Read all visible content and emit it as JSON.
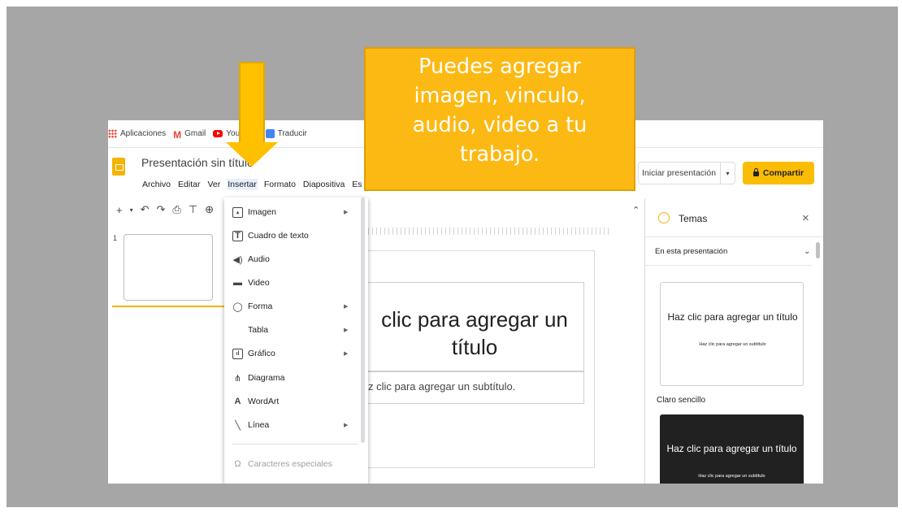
{
  "bookmarks": [
    {
      "icon": "apps-icon",
      "label": "Aplicaciones"
    },
    {
      "icon": "gmail-icon",
      "label": "Gmail"
    },
    {
      "icon": "youtube-icon",
      "label": "YouTube"
    },
    {
      "icon": "translate-icon",
      "label": "Traducir"
    }
  ],
  "header": {
    "doc_title": "Presentación sin título",
    "menus": [
      "Archivo",
      "Editar",
      "Ver",
      "Insertar",
      "Formato",
      "Diapositiva",
      "Es"
    ],
    "active_menu": "Insertar",
    "present_label": "Iniciar presentación",
    "share_label": "Compartir"
  },
  "filmstrip": {
    "slide_number": "1"
  },
  "insert_menu": {
    "items": [
      {
        "icon": "image-icon",
        "label": "Imagen",
        "submenu": true,
        "enabled": true
      },
      {
        "icon": "text-box-icon",
        "label": "Cuadro de texto",
        "submenu": false,
        "enabled": true
      },
      {
        "icon": "audio-icon",
        "label": "Audio",
        "submenu": false,
        "enabled": true
      },
      {
        "icon": "video-icon",
        "label": "Video",
        "submenu": false,
        "enabled": true
      },
      {
        "icon": "shape-icon",
        "label": "Forma",
        "submenu": true,
        "enabled": true
      },
      {
        "icon": "",
        "label": "Tabla",
        "submenu": true,
        "enabled": true
      },
      {
        "icon": "chart-icon",
        "label": "Gráfico",
        "submenu": true,
        "enabled": true
      },
      {
        "icon": "diagram-icon",
        "label": "Diagrama",
        "submenu": false,
        "enabled": true
      },
      {
        "icon": "wordart-icon",
        "label": "WordArt",
        "submenu": false,
        "enabled": true
      },
      {
        "icon": "line-icon",
        "label": "Línea",
        "submenu": true,
        "enabled": true
      },
      {
        "icon": "omega-icon",
        "label": "Caracteres especiales",
        "submenu": false,
        "enabled": false
      }
    ]
  },
  "slide": {
    "title_placeholder": "clic para agregar un título",
    "subtitle_placeholder": "z clic para agregar un subtítulo."
  },
  "themes_panel": {
    "title": "Temas",
    "filter": "En esta presentación",
    "themes": [
      {
        "name": "Claro sencillo",
        "title": "Haz clic para agregar un título",
        "subtitle": "Haz clic para agregar un subtítulo",
        "style": "light"
      },
      {
        "name": "",
        "title": "Haz clic para agregar un título",
        "subtitle": "Haz clic para agregar un subtítulo",
        "style": "dark"
      }
    ]
  },
  "callout": {
    "lines": [
      "Puedes agregar",
      "imagen, vinculo,",
      "audio, video a tu",
      "trabajo."
    ]
  },
  "colors": {
    "accent": "#fbbc04",
    "callout_bg": "#fdb913",
    "arrow": "#ffc000",
    "slide_frame": "#a6a6a6"
  }
}
